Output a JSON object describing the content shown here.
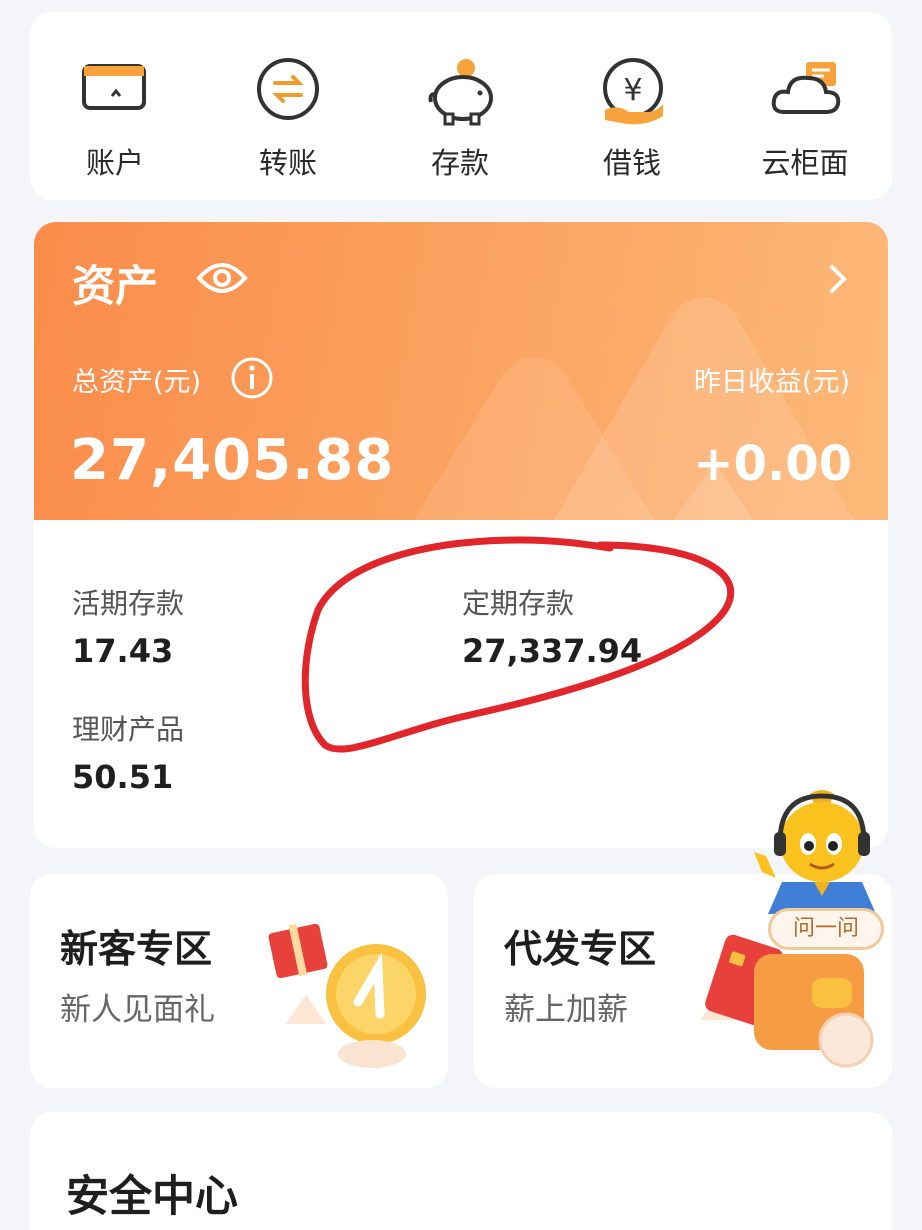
{
  "quick_actions": [
    {
      "label": "账户",
      "icon": "account-card-icon"
    },
    {
      "label": "转账",
      "icon": "transfer-icon"
    },
    {
      "label": "存款",
      "icon": "piggy-bank-icon"
    },
    {
      "label": "借钱",
      "icon": "borrow-yuan-icon"
    },
    {
      "label": "云柜面",
      "icon": "cloud-counter-icon"
    }
  ],
  "assets": {
    "title": "资产",
    "total_label": "总资产(元)",
    "total_value": "27,405.88",
    "yesterday_label": "昨日收益(元)",
    "yesterday_value": "+0.00",
    "items": [
      {
        "label": "活期存款",
        "value": "17.43"
      },
      {
        "label": "定期存款",
        "value": "27,337.94"
      },
      {
        "label": "理财产品",
        "value": "50.51"
      }
    ]
  },
  "promos": [
    {
      "title": "新客专区",
      "subtitle": "新人见面礼"
    },
    {
      "title": "代发专区",
      "subtitle": "薪上加薪"
    }
  ],
  "assistant": {
    "button_label": "问一问"
  },
  "security": {
    "title": "安全中心"
  },
  "colors": {
    "accent_orange": "#fb8c4a",
    "annotation_red": "#e0262b",
    "background": "#f4f5f8"
  }
}
